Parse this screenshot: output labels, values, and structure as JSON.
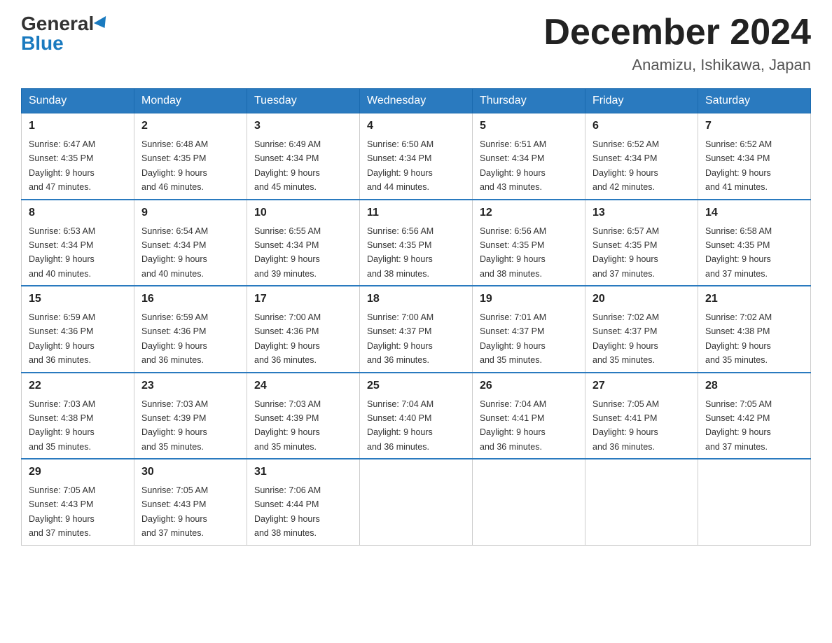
{
  "header": {
    "logo_general": "General",
    "logo_blue": "Blue",
    "month_year": "December 2024",
    "location": "Anamizu, Ishikawa, Japan"
  },
  "days_of_week": [
    "Sunday",
    "Monday",
    "Tuesday",
    "Wednesday",
    "Thursday",
    "Friday",
    "Saturday"
  ],
  "weeks": [
    [
      {
        "day": "1",
        "sunrise": "6:47 AM",
        "sunset": "4:35 PM",
        "daylight": "9 hours and 47 minutes."
      },
      {
        "day": "2",
        "sunrise": "6:48 AM",
        "sunset": "4:35 PM",
        "daylight": "9 hours and 46 minutes."
      },
      {
        "day": "3",
        "sunrise": "6:49 AM",
        "sunset": "4:34 PM",
        "daylight": "9 hours and 45 minutes."
      },
      {
        "day": "4",
        "sunrise": "6:50 AM",
        "sunset": "4:34 PM",
        "daylight": "9 hours and 44 minutes."
      },
      {
        "day": "5",
        "sunrise": "6:51 AM",
        "sunset": "4:34 PM",
        "daylight": "9 hours and 43 minutes."
      },
      {
        "day": "6",
        "sunrise": "6:52 AM",
        "sunset": "4:34 PM",
        "daylight": "9 hours and 42 minutes."
      },
      {
        "day": "7",
        "sunrise": "6:52 AM",
        "sunset": "4:34 PM",
        "daylight": "9 hours and 41 minutes."
      }
    ],
    [
      {
        "day": "8",
        "sunrise": "6:53 AM",
        "sunset": "4:34 PM",
        "daylight": "9 hours and 40 minutes."
      },
      {
        "day": "9",
        "sunrise": "6:54 AM",
        "sunset": "4:34 PM",
        "daylight": "9 hours and 40 minutes."
      },
      {
        "day": "10",
        "sunrise": "6:55 AM",
        "sunset": "4:34 PM",
        "daylight": "9 hours and 39 minutes."
      },
      {
        "day": "11",
        "sunrise": "6:56 AM",
        "sunset": "4:35 PM",
        "daylight": "9 hours and 38 minutes."
      },
      {
        "day": "12",
        "sunrise": "6:56 AM",
        "sunset": "4:35 PM",
        "daylight": "9 hours and 38 minutes."
      },
      {
        "day": "13",
        "sunrise": "6:57 AM",
        "sunset": "4:35 PM",
        "daylight": "9 hours and 37 minutes."
      },
      {
        "day": "14",
        "sunrise": "6:58 AM",
        "sunset": "4:35 PM",
        "daylight": "9 hours and 37 minutes."
      }
    ],
    [
      {
        "day": "15",
        "sunrise": "6:59 AM",
        "sunset": "4:36 PM",
        "daylight": "9 hours and 36 minutes."
      },
      {
        "day": "16",
        "sunrise": "6:59 AM",
        "sunset": "4:36 PM",
        "daylight": "9 hours and 36 minutes."
      },
      {
        "day": "17",
        "sunrise": "7:00 AM",
        "sunset": "4:36 PM",
        "daylight": "9 hours and 36 minutes."
      },
      {
        "day": "18",
        "sunrise": "7:00 AM",
        "sunset": "4:37 PM",
        "daylight": "9 hours and 36 minutes."
      },
      {
        "day": "19",
        "sunrise": "7:01 AM",
        "sunset": "4:37 PM",
        "daylight": "9 hours and 35 minutes."
      },
      {
        "day": "20",
        "sunrise": "7:02 AM",
        "sunset": "4:37 PM",
        "daylight": "9 hours and 35 minutes."
      },
      {
        "day": "21",
        "sunrise": "7:02 AM",
        "sunset": "4:38 PM",
        "daylight": "9 hours and 35 minutes."
      }
    ],
    [
      {
        "day": "22",
        "sunrise": "7:03 AM",
        "sunset": "4:38 PM",
        "daylight": "9 hours and 35 minutes."
      },
      {
        "day": "23",
        "sunrise": "7:03 AM",
        "sunset": "4:39 PM",
        "daylight": "9 hours and 35 minutes."
      },
      {
        "day": "24",
        "sunrise": "7:03 AM",
        "sunset": "4:39 PM",
        "daylight": "9 hours and 35 minutes."
      },
      {
        "day": "25",
        "sunrise": "7:04 AM",
        "sunset": "4:40 PM",
        "daylight": "9 hours and 36 minutes."
      },
      {
        "day": "26",
        "sunrise": "7:04 AM",
        "sunset": "4:41 PM",
        "daylight": "9 hours and 36 minutes."
      },
      {
        "day": "27",
        "sunrise": "7:05 AM",
        "sunset": "4:41 PM",
        "daylight": "9 hours and 36 minutes."
      },
      {
        "day": "28",
        "sunrise": "7:05 AM",
        "sunset": "4:42 PM",
        "daylight": "9 hours and 37 minutes."
      }
    ],
    [
      {
        "day": "29",
        "sunrise": "7:05 AM",
        "sunset": "4:43 PM",
        "daylight": "9 hours and 37 minutes."
      },
      {
        "day": "30",
        "sunrise": "7:05 AM",
        "sunset": "4:43 PM",
        "daylight": "9 hours and 37 minutes."
      },
      {
        "day": "31",
        "sunrise": "7:06 AM",
        "sunset": "4:44 PM",
        "daylight": "9 hours and 38 minutes."
      },
      null,
      null,
      null,
      null
    ]
  ],
  "labels": {
    "sunrise_prefix": "Sunrise: ",
    "sunset_prefix": "Sunset: ",
    "daylight_prefix": "Daylight: "
  }
}
